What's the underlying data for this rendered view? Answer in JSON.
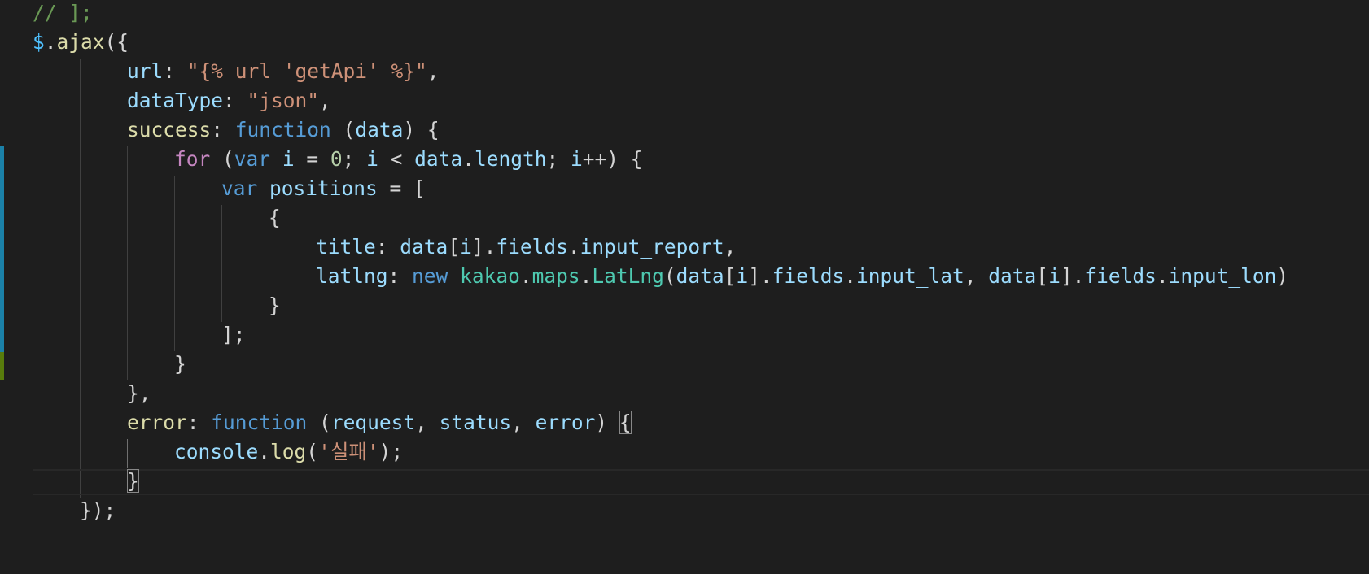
{
  "editor": {
    "language": "javascript",
    "colors": {
      "background": "#1e1e1e",
      "comment": "#6a9955",
      "keyword": "#569cd6",
      "control": "#c586c0",
      "string": "#ce9178",
      "number": "#b5cea8",
      "function": "#dcdcaa",
      "variable": "#9cdcfe",
      "type": "#4ec9b0",
      "punctuation": "#d4d4d4",
      "git_modified": "#1b81a8",
      "git_added": "#587c0c"
    },
    "lines": [
      {
        "indent": 0,
        "tokens": [
          {
            "t": "// ];",
            "c": "#6a9955"
          }
        ]
      },
      {
        "indent": 0,
        "tokens": [
          {
            "t": "$",
            "c": "#4fc1ff"
          },
          {
            "t": ".",
            "c": "#d4d4d4"
          },
          {
            "t": "ajax",
            "c": "#dcdcaa"
          },
          {
            "t": "({",
            "c": "#d4d4d4"
          }
        ]
      },
      {
        "indent": 2,
        "tokens": [
          {
            "t": "url",
            "c": "#9cdcfe"
          },
          {
            "t": ": ",
            "c": "#d4d4d4"
          },
          {
            "t": "\"{% url 'getApi' %}\"",
            "c": "#ce9178"
          },
          {
            "t": ",",
            "c": "#d4d4d4"
          }
        ]
      },
      {
        "indent": 2,
        "tokens": [
          {
            "t": "dataType",
            "c": "#9cdcfe"
          },
          {
            "t": ": ",
            "c": "#d4d4d4"
          },
          {
            "t": "\"json\"",
            "c": "#ce9178"
          },
          {
            "t": ",",
            "c": "#d4d4d4"
          }
        ]
      },
      {
        "indent": 2,
        "tokens": [
          {
            "t": "success",
            "c": "#dcdcaa"
          },
          {
            "t": ": ",
            "c": "#d4d4d4"
          },
          {
            "t": "function",
            "c": "#569cd6"
          },
          {
            "t": " (",
            "c": "#d4d4d4"
          },
          {
            "t": "data",
            "c": "#9cdcfe"
          },
          {
            "t": ") {",
            "c": "#d4d4d4"
          }
        ]
      },
      {
        "indent": 3,
        "tokens": [
          {
            "t": "for",
            "c": "#c586c0"
          },
          {
            "t": " (",
            "c": "#d4d4d4"
          },
          {
            "t": "var",
            "c": "#569cd6"
          },
          {
            "t": " ",
            "c": "#d4d4d4"
          },
          {
            "t": "i",
            "c": "#9cdcfe"
          },
          {
            "t": " = ",
            "c": "#d4d4d4"
          },
          {
            "t": "0",
            "c": "#b5cea8"
          },
          {
            "t": "; ",
            "c": "#d4d4d4"
          },
          {
            "t": "i",
            "c": "#9cdcfe"
          },
          {
            "t": " < ",
            "c": "#d4d4d4"
          },
          {
            "t": "data",
            "c": "#9cdcfe"
          },
          {
            "t": ".",
            "c": "#d4d4d4"
          },
          {
            "t": "length",
            "c": "#9cdcfe"
          },
          {
            "t": "; ",
            "c": "#d4d4d4"
          },
          {
            "t": "i",
            "c": "#9cdcfe"
          },
          {
            "t": "++) {",
            "c": "#d4d4d4"
          }
        ]
      },
      {
        "indent": 4,
        "tokens": [
          {
            "t": "var",
            "c": "#569cd6"
          },
          {
            "t": " ",
            "c": "#d4d4d4"
          },
          {
            "t": "positions",
            "c": "#9cdcfe"
          },
          {
            "t": " = [",
            "c": "#d4d4d4"
          }
        ]
      },
      {
        "indent": 5,
        "tokens": [
          {
            "t": "{",
            "c": "#d4d4d4"
          }
        ]
      },
      {
        "indent": 6,
        "tokens": [
          {
            "t": "title",
            "c": "#9cdcfe"
          },
          {
            "t": ": ",
            "c": "#d4d4d4"
          },
          {
            "t": "data",
            "c": "#9cdcfe"
          },
          {
            "t": "[",
            "c": "#d4d4d4"
          },
          {
            "t": "i",
            "c": "#9cdcfe"
          },
          {
            "t": "].",
            "c": "#d4d4d4"
          },
          {
            "t": "fields",
            "c": "#9cdcfe"
          },
          {
            "t": ".",
            "c": "#d4d4d4"
          },
          {
            "t": "input_report",
            "c": "#9cdcfe"
          },
          {
            "t": ",",
            "c": "#d4d4d4"
          }
        ]
      },
      {
        "indent": 6,
        "tokens": [
          {
            "t": "latlng",
            "c": "#9cdcfe"
          },
          {
            "t": ": ",
            "c": "#d4d4d4"
          },
          {
            "t": "new",
            "c": "#569cd6"
          },
          {
            "t": " ",
            "c": "#d4d4d4"
          },
          {
            "t": "kakao",
            "c": "#4ec9b0"
          },
          {
            "t": ".",
            "c": "#d4d4d4"
          },
          {
            "t": "maps",
            "c": "#4ec9b0"
          },
          {
            "t": ".",
            "c": "#d4d4d4"
          },
          {
            "t": "LatLng",
            "c": "#4ec9b0"
          },
          {
            "t": "(",
            "c": "#d4d4d4"
          },
          {
            "t": "data",
            "c": "#9cdcfe"
          },
          {
            "t": "[",
            "c": "#d4d4d4"
          },
          {
            "t": "i",
            "c": "#9cdcfe"
          },
          {
            "t": "].",
            "c": "#d4d4d4"
          },
          {
            "t": "fields",
            "c": "#9cdcfe"
          },
          {
            "t": ".",
            "c": "#d4d4d4"
          },
          {
            "t": "input_lat",
            "c": "#9cdcfe"
          },
          {
            "t": ", ",
            "c": "#d4d4d4"
          },
          {
            "t": "data",
            "c": "#9cdcfe"
          },
          {
            "t": "[",
            "c": "#d4d4d4"
          },
          {
            "t": "i",
            "c": "#9cdcfe"
          },
          {
            "t": "].",
            "c": "#d4d4d4"
          },
          {
            "t": "fields",
            "c": "#9cdcfe"
          },
          {
            "t": ".",
            "c": "#d4d4d4"
          },
          {
            "t": "input_lon",
            "c": "#9cdcfe"
          },
          {
            "t": ")",
            "c": "#d4d4d4"
          }
        ]
      },
      {
        "indent": 5,
        "tokens": [
          {
            "t": "}",
            "c": "#d4d4d4"
          }
        ]
      },
      {
        "indent": 4,
        "tokens": [
          {
            "t": "];",
            "c": "#d4d4d4"
          }
        ]
      },
      {
        "indent": 3,
        "tokens": [
          {
            "t": "}",
            "c": "#d4d4d4"
          }
        ]
      },
      {
        "indent": 2,
        "tokens": [
          {
            "t": "},",
            "c": "#d4d4d4"
          }
        ]
      },
      {
        "indent": 2,
        "tokens": [
          {
            "t": "error",
            "c": "#dcdcaa"
          },
          {
            "t": ": ",
            "c": "#d4d4d4"
          },
          {
            "t": "function",
            "c": "#569cd6"
          },
          {
            "t": " (",
            "c": "#d4d4d4"
          },
          {
            "t": "request",
            "c": "#9cdcfe"
          },
          {
            "t": ", ",
            "c": "#d4d4d4"
          },
          {
            "t": "status",
            "c": "#9cdcfe"
          },
          {
            "t": ", ",
            "c": "#d4d4d4"
          },
          {
            "t": "error",
            "c": "#9cdcfe"
          },
          {
            "t": ") ",
            "c": "#d4d4d4"
          },
          {
            "t": "{",
            "c": "#d4d4d4",
            "bracket_match": true
          }
        ]
      },
      {
        "indent": 3,
        "tokens": [
          {
            "t": "console",
            "c": "#9cdcfe"
          },
          {
            "t": ".",
            "c": "#d4d4d4"
          },
          {
            "t": "log",
            "c": "#dcdcaa"
          },
          {
            "t": "(",
            "c": "#d4d4d4"
          },
          {
            "t": "'실패'",
            "c": "#ce9178"
          },
          {
            "t": ");",
            "c": "#d4d4d4"
          }
        ]
      },
      {
        "indent": 2,
        "tokens": [
          {
            "t": "}",
            "c": "#d4d4d4",
            "bracket_match": true
          }
        ]
      },
      {
        "indent": 1,
        "tokens": [
          {
            "t": "});",
            "c": "#d4d4d4"
          }
        ]
      }
    ]
  }
}
